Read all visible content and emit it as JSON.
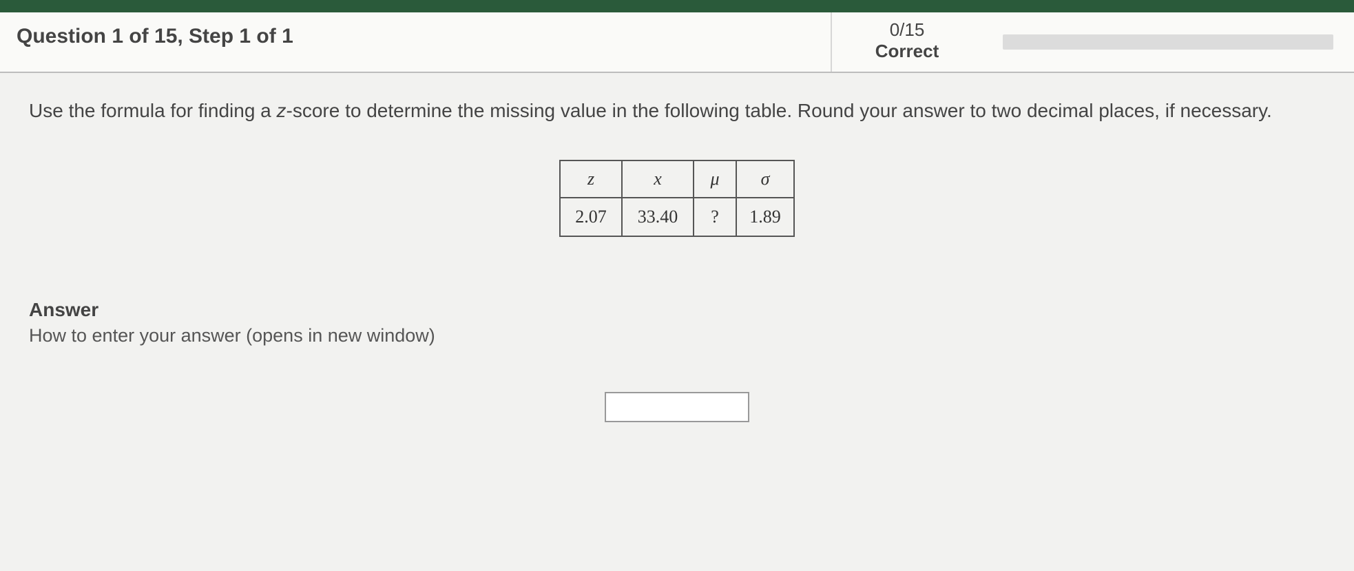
{
  "header": {
    "title": "Question 1 of 15, Step 1 of 1",
    "score": "0/15",
    "score_label": "Correct"
  },
  "question": {
    "text_before_z": "Use the formula for finding a ",
    "z_text": "z",
    "text_after_z": "-score to determine the missing value in the following table. Round your answer to two decimal places, if necessary."
  },
  "table": {
    "headers": {
      "z": "z",
      "x": "x",
      "mu": "μ",
      "sigma": "σ"
    },
    "row": {
      "z": "2.07",
      "x": "33.40",
      "mu": "?",
      "sigma": "1.89"
    }
  },
  "answer": {
    "title": "Answer",
    "link_text": "How to enter your answer (opens in new window)",
    "input_value": ""
  }
}
